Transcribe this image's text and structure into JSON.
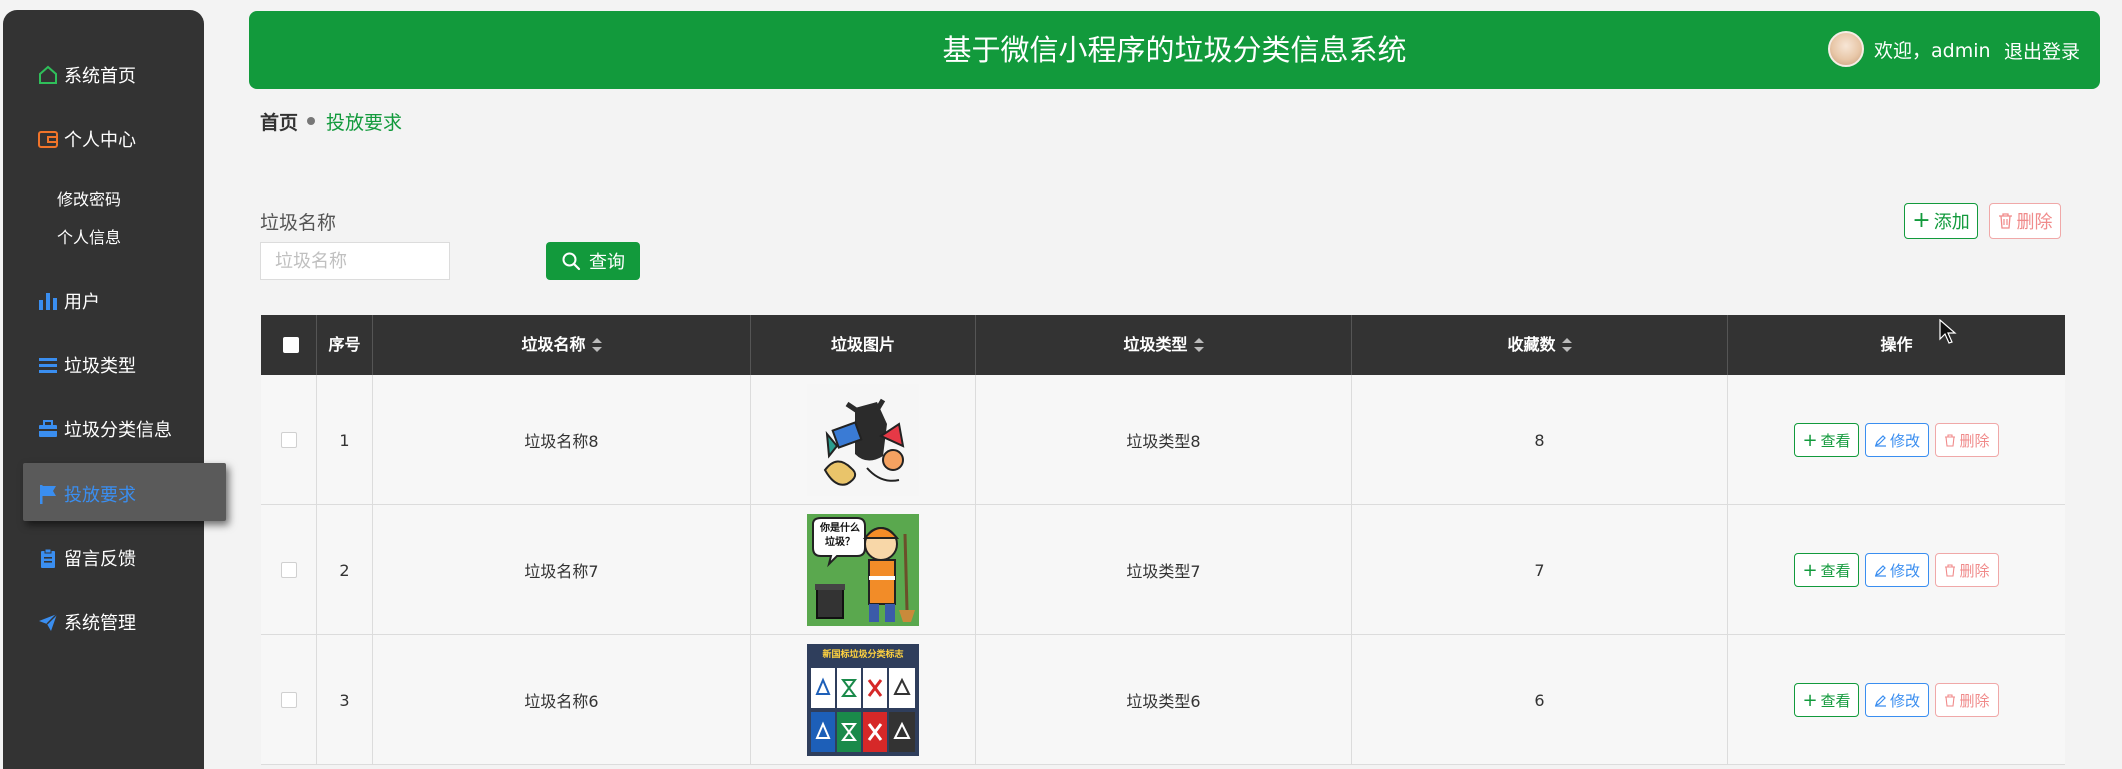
{
  "sidebar": {
    "items": [
      {
        "label": "系统首页",
        "icon": "home-icon"
      },
      {
        "label": "个人中心",
        "icon": "wallet-icon"
      },
      {
        "label": "用户",
        "icon": "bar-chart-icon"
      },
      {
        "label": "垃圾类型",
        "icon": "list-icon"
      },
      {
        "label": "垃圾分类信息",
        "icon": "briefcase-icon"
      },
      {
        "label": "投放要求",
        "icon": "flag-icon"
      },
      {
        "label": "留言反馈",
        "icon": "clipboard-icon"
      },
      {
        "label": "系统管理",
        "icon": "paper-plane-icon"
      }
    ],
    "sub_items": [
      "修改密码",
      "个人信息"
    ],
    "active": "投放要求"
  },
  "header": {
    "title": "基于微信小程序的垃圾分类信息系统",
    "welcome": "欢迎，admin",
    "logout": "退出登录"
  },
  "breadcrumb": {
    "home": "首页",
    "current": "投放要求"
  },
  "search": {
    "label": "垃圾名称",
    "placeholder": "垃圾名称",
    "value": "",
    "button": "查询"
  },
  "actions": {
    "add": "添加",
    "delete": "删除"
  },
  "table": {
    "headers": [
      "序号",
      "垃圾名称",
      "垃圾图片",
      "垃圾类型",
      "收藏数",
      "操作"
    ],
    "rows": [
      {
        "index": "1",
        "name": "垃圾名称8",
        "type": "垃圾类型8",
        "favorites": "8"
      },
      {
        "index": "2",
        "name": "垃圾名称7",
        "type": "垃圾类型7",
        "favorites": "7"
      },
      {
        "index": "3",
        "name": "垃圾名称6",
        "type": "垃圾类型6",
        "favorites": "6"
      }
    ],
    "row_actions": {
      "view": "查看",
      "edit": "修改",
      "delete": "删除"
    },
    "image_texts": {
      "row2": [
        "你是什么",
        "垃圾？"
      ],
      "row3": [
        "新国标垃圾分类标志"
      ]
    }
  },
  "colors": {
    "primary": "#129a3c",
    "sidebar_bg": "#333333",
    "active_text": "#3a8ef0",
    "danger": "#f08a8a",
    "edit": "#3a8ef0"
  }
}
